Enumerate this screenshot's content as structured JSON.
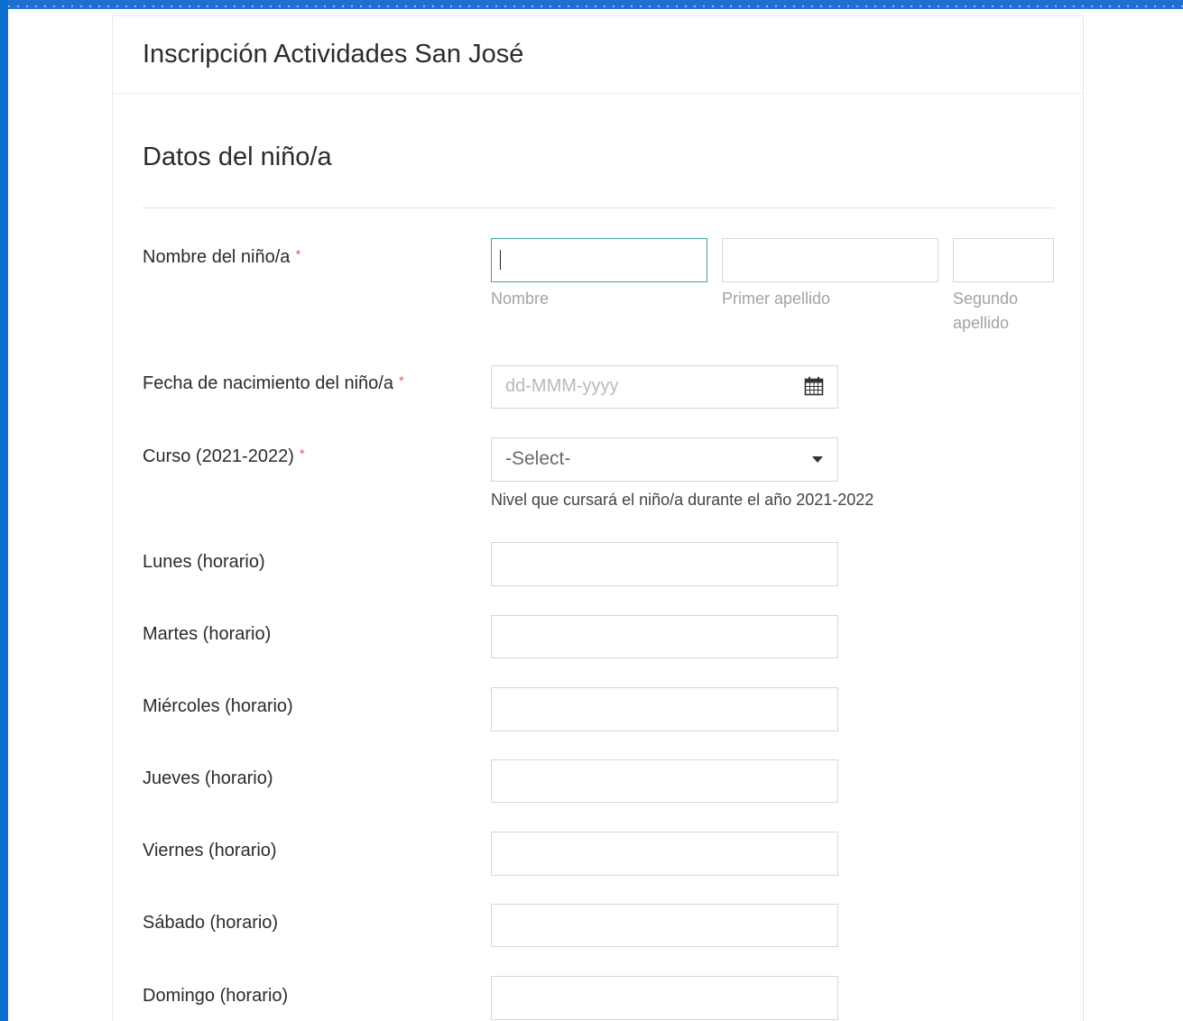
{
  "form": {
    "title": "Inscripción Actividades San José",
    "section_title": "Datos del niño/a"
  },
  "fields": {
    "child_name": {
      "label": "Nombre del niño/a",
      "required_mark": "*",
      "first_name_sublabel": "Nombre",
      "first_surname_sublabel": "Primer apellido",
      "second_surname_sublabel_line1": "Segundo",
      "second_surname_sublabel_line2": "apellido"
    },
    "birth_date": {
      "label": "Fecha de nacimiento del niño/a",
      "required_mark": "*",
      "placeholder": "dd-MMM-yyyy",
      "icon": "calendar-icon"
    },
    "course": {
      "label": "Curso (2021-2022)",
      "required_mark": "*",
      "selected": "-Select-",
      "help": "Nivel que cursará el niño/a durante el año 2021-2022",
      "icon": "chevron-down-icon"
    },
    "schedule": [
      {
        "label": "Lunes (horario)",
        "value": ""
      },
      {
        "label": "Martes (horario)",
        "value": ""
      },
      {
        "label": "Miércoles (horario)",
        "value": ""
      },
      {
        "label": "Jueves (horario)",
        "value": ""
      },
      {
        "label": "Viernes (horario)",
        "value": ""
      },
      {
        "label": "Sábado (horario)",
        "value": ""
      },
      {
        "label": "Domingo (horario)",
        "value": ""
      }
    ]
  },
  "colors": {
    "page_edge_blue": "#0a6fd1",
    "focus_border": "#4aa39c",
    "required_red": "#e0645b"
  }
}
